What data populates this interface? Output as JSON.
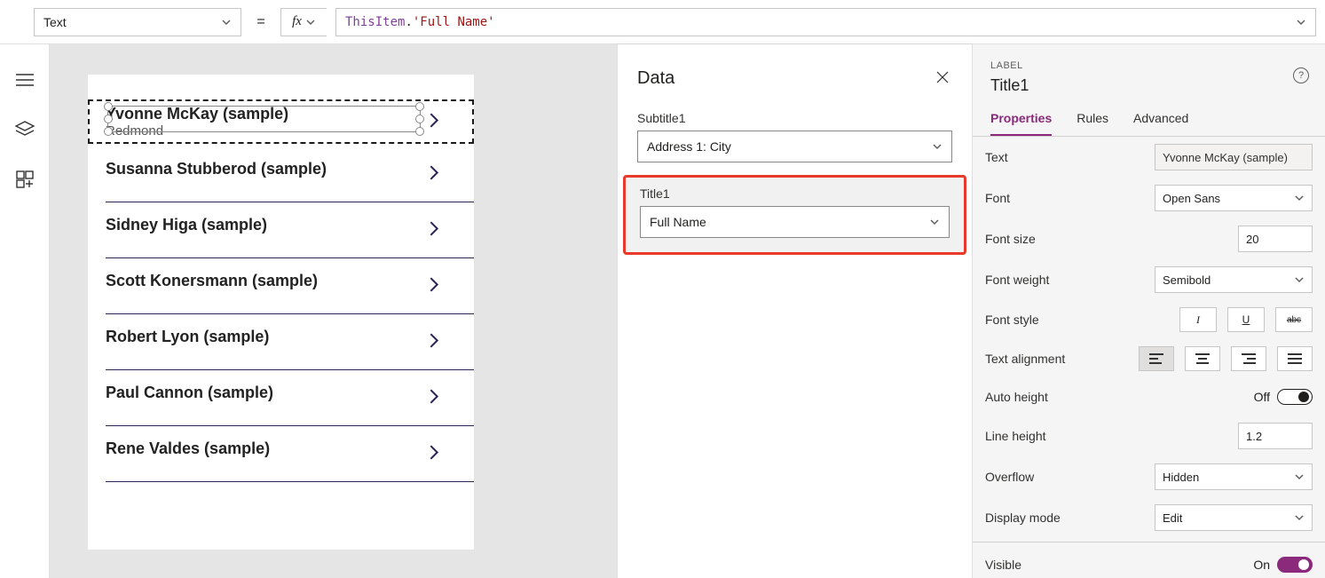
{
  "formula_bar": {
    "property": "Text",
    "fx_label": "fx",
    "formula_tokens": {
      "this": "ThisItem",
      "dot": ".",
      "field": "'Full Name'"
    }
  },
  "gallery_items": [
    {
      "title": "Yvonne McKay (sample)",
      "subtitle": "Redmond"
    },
    {
      "title": "Susanna Stubberod (sample)"
    },
    {
      "title": "Sidney Higa (sample)"
    },
    {
      "title": "Scott Konersmann (sample)"
    },
    {
      "title": "Robert Lyon (sample)"
    },
    {
      "title": "Paul Cannon (sample)"
    },
    {
      "title": "Rene Valdes (sample)"
    }
  ],
  "data_panel": {
    "heading": "Data",
    "fields": [
      {
        "label": "Subtitle1",
        "value": "Address 1: City"
      },
      {
        "label": "Title1",
        "value": "Full Name"
      }
    ]
  },
  "props_panel": {
    "kind": "LABEL",
    "control_name": "Title1",
    "tabs": [
      "Properties",
      "Rules",
      "Advanced"
    ],
    "rows": {
      "text_label": "Text",
      "text_value": "Yvonne McKay (sample)",
      "font_label": "Font",
      "font_value": "Open Sans",
      "fontsize_label": "Font size",
      "fontsize_value": "20",
      "fontweight_label": "Font weight",
      "fontweight_value": "Semibold",
      "fontstyle_label": "Font style",
      "align_label": "Text alignment",
      "autoheight_label": "Auto height",
      "autoheight_state": "Off",
      "lineheight_label": "Line height",
      "lineheight_value": "1.2",
      "overflow_label": "Overflow",
      "overflow_value": "Hidden",
      "displaymode_label": "Display mode",
      "displaymode_value": "Edit",
      "visible_label": "Visible",
      "visible_state": "On"
    },
    "style_buttons": {
      "italic": "I",
      "underline": "U",
      "strike": "abc"
    }
  }
}
